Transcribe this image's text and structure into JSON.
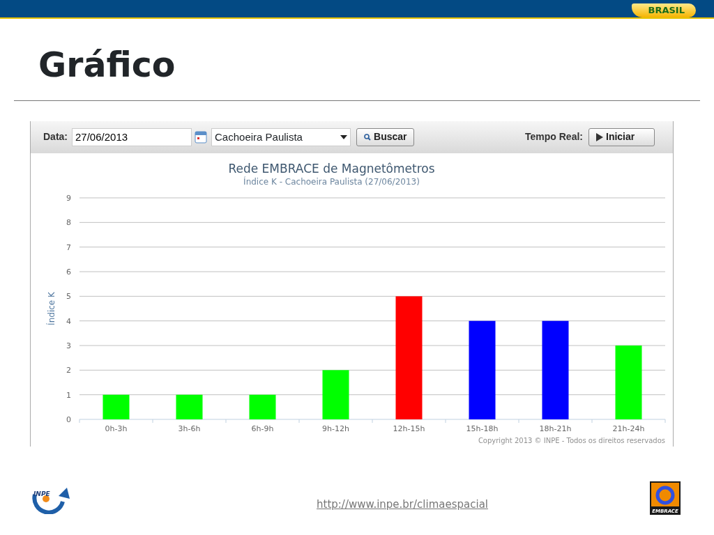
{
  "header": {
    "logo_text": "BRASIL"
  },
  "slide_title": "Gráfico",
  "toolbar": {
    "date_label": "Data:",
    "date_value": "27/06/2013",
    "station": "Cachoeira Paulista",
    "search_button": "Buscar",
    "realtime_label": "Tempo Real:",
    "start_button": "Iniciar"
  },
  "chart": {
    "copyright": "Copyright 2013 © INPE - Todos os direitos reservados",
    "chart_data": {
      "type": "bar",
      "title": "Rede EMBRACE de Magnetômetros",
      "subtitle": "Índice K - Cachoeira Paulista (27/06/2013)",
      "ylabel": "Índice K",
      "categories": [
        "0h-3h",
        "3h-6h",
        "6h-9h",
        "9h-12h",
        "12h-15h",
        "15h-18h",
        "18h-21h",
        "21h-24h"
      ],
      "series": [
        {
          "color": "#00ff00",
          "values": [
            1,
            1,
            1,
            2,
            null,
            null,
            null,
            3
          ]
        },
        {
          "color": "#ff0000",
          "values": [
            null,
            null,
            null,
            null,
            5,
            null,
            null,
            null
          ]
        },
        {
          "color": "#0000ff",
          "values": [
            null,
            null,
            null,
            null,
            null,
            4,
            4,
            null
          ]
        }
      ],
      "stacked": true,
      "grid": true,
      "ylim": [
        0,
        9
      ],
      "yticks": [
        0,
        1,
        2,
        3,
        4,
        5,
        6,
        7,
        8,
        9
      ]
    }
  },
  "footer": {
    "left_logo_text": "INPE",
    "url": "http://www.inpe.br/climaespacial",
    "right_logo_text": "EMBRACE"
  }
}
